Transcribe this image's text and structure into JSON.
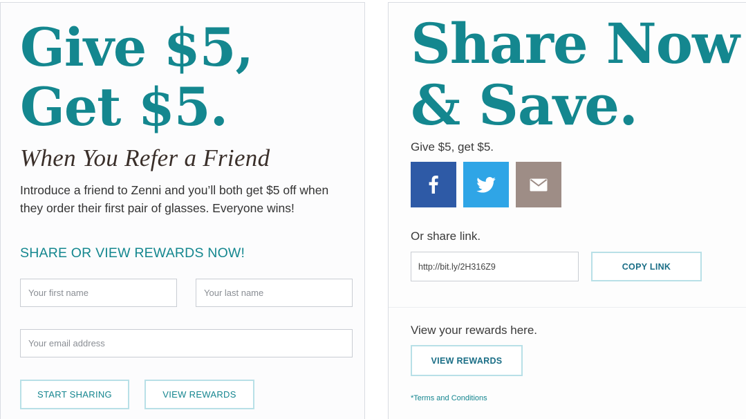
{
  "left": {
    "headline_line1": "Give $5,",
    "headline_line2": "Get $5.",
    "subtitle": "When You Refer a Friend",
    "intro": "Introduce a friend to Zenni and you’ll both get $5 off when they order their first pair of glasses. Everyone wins!",
    "cta_heading": "SHARE OR VIEW REWARDS NOW!",
    "first_name_placeholder": "Your first name",
    "last_name_placeholder": "Your last name",
    "email_placeholder": "Your email address",
    "start_sharing_label": "START SHARING",
    "view_rewards_label": "VIEW REWARDS"
  },
  "right": {
    "headline_line1": "Share Now",
    "headline_line2": "& Save.",
    "tagline": "Give $5, get $5.",
    "social": [
      {
        "name": "facebook",
        "icon": "facebook-icon",
        "color": "#2e5aa6"
      },
      {
        "name": "twitter",
        "icon": "twitter-icon",
        "color": "#2fa5e6"
      },
      {
        "name": "email",
        "icon": "envelope-icon",
        "color": "#9e8d86"
      }
    ],
    "share_link_label": "Or share link.",
    "share_link_value": "http://bit.ly/2H316Z9",
    "copy_link_label": "COPY LINK",
    "view_rewards_text": "View your rewards here.",
    "view_rewards_label": "VIEW REWARDS",
    "terms_label": "*Terms and Conditions"
  },
  "colors": {
    "accent": "#14878f",
    "button_border": "#b8e0e7"
  }
}
